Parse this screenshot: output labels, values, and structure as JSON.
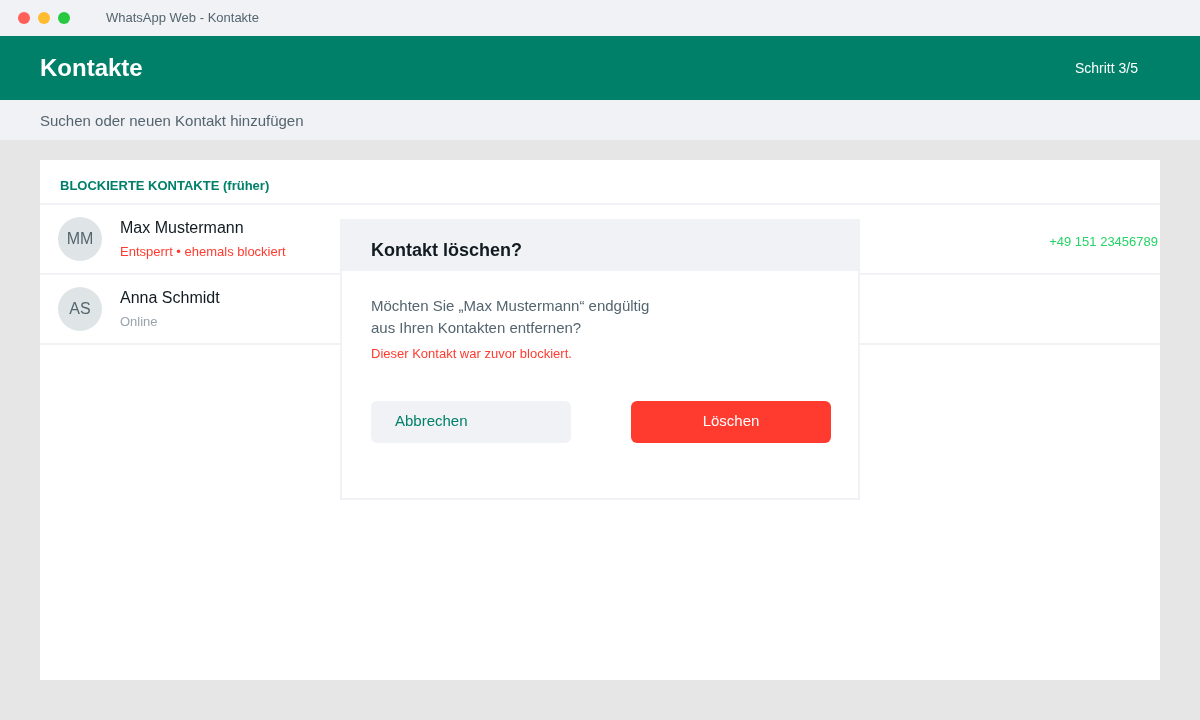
{
  "window": {
    "title": "WhatsApp Web - Kontakte"
  },
  "header": {
    "title": "Kontakte",
    "step": "Schritt 3/5"
  },
  "search": {
    "placeholder": "Suchen oder neuen Kontakt hinzufügen"
  },
  "section": {
    "title": "BLOCKIERTE KONTAKTE",
    "note": "(früher)"
  },
  "contacts": [
    {
      "initials": "MM",
      "name": "Max Mustermann",
      "status": "Entsperrt • ehemals blockiert",
      "kind": "warning",
      "phone": "+49 151 23456789"
    },
    {
      "initials": "AS",
      "name": "Anna Schmidt",
      "status": "Online",
      "kind": "normal"
    }
  ],
  "dialog": {
    "title": "Kontakt löschen?",
    "message": "Möchten Sie „Max Mustermann“ endgültig aus Ihren Kontakten entfernen?",
    "warning": "Dieser Kontakt war zuvor blockiert.",
    "buttons": [
      {
        "label": "Abbrechen",
        "kind": "secondary"
      },
      {
        "label": "Löschen",
        "kind": "danger"
      }
    ]
  }
}
